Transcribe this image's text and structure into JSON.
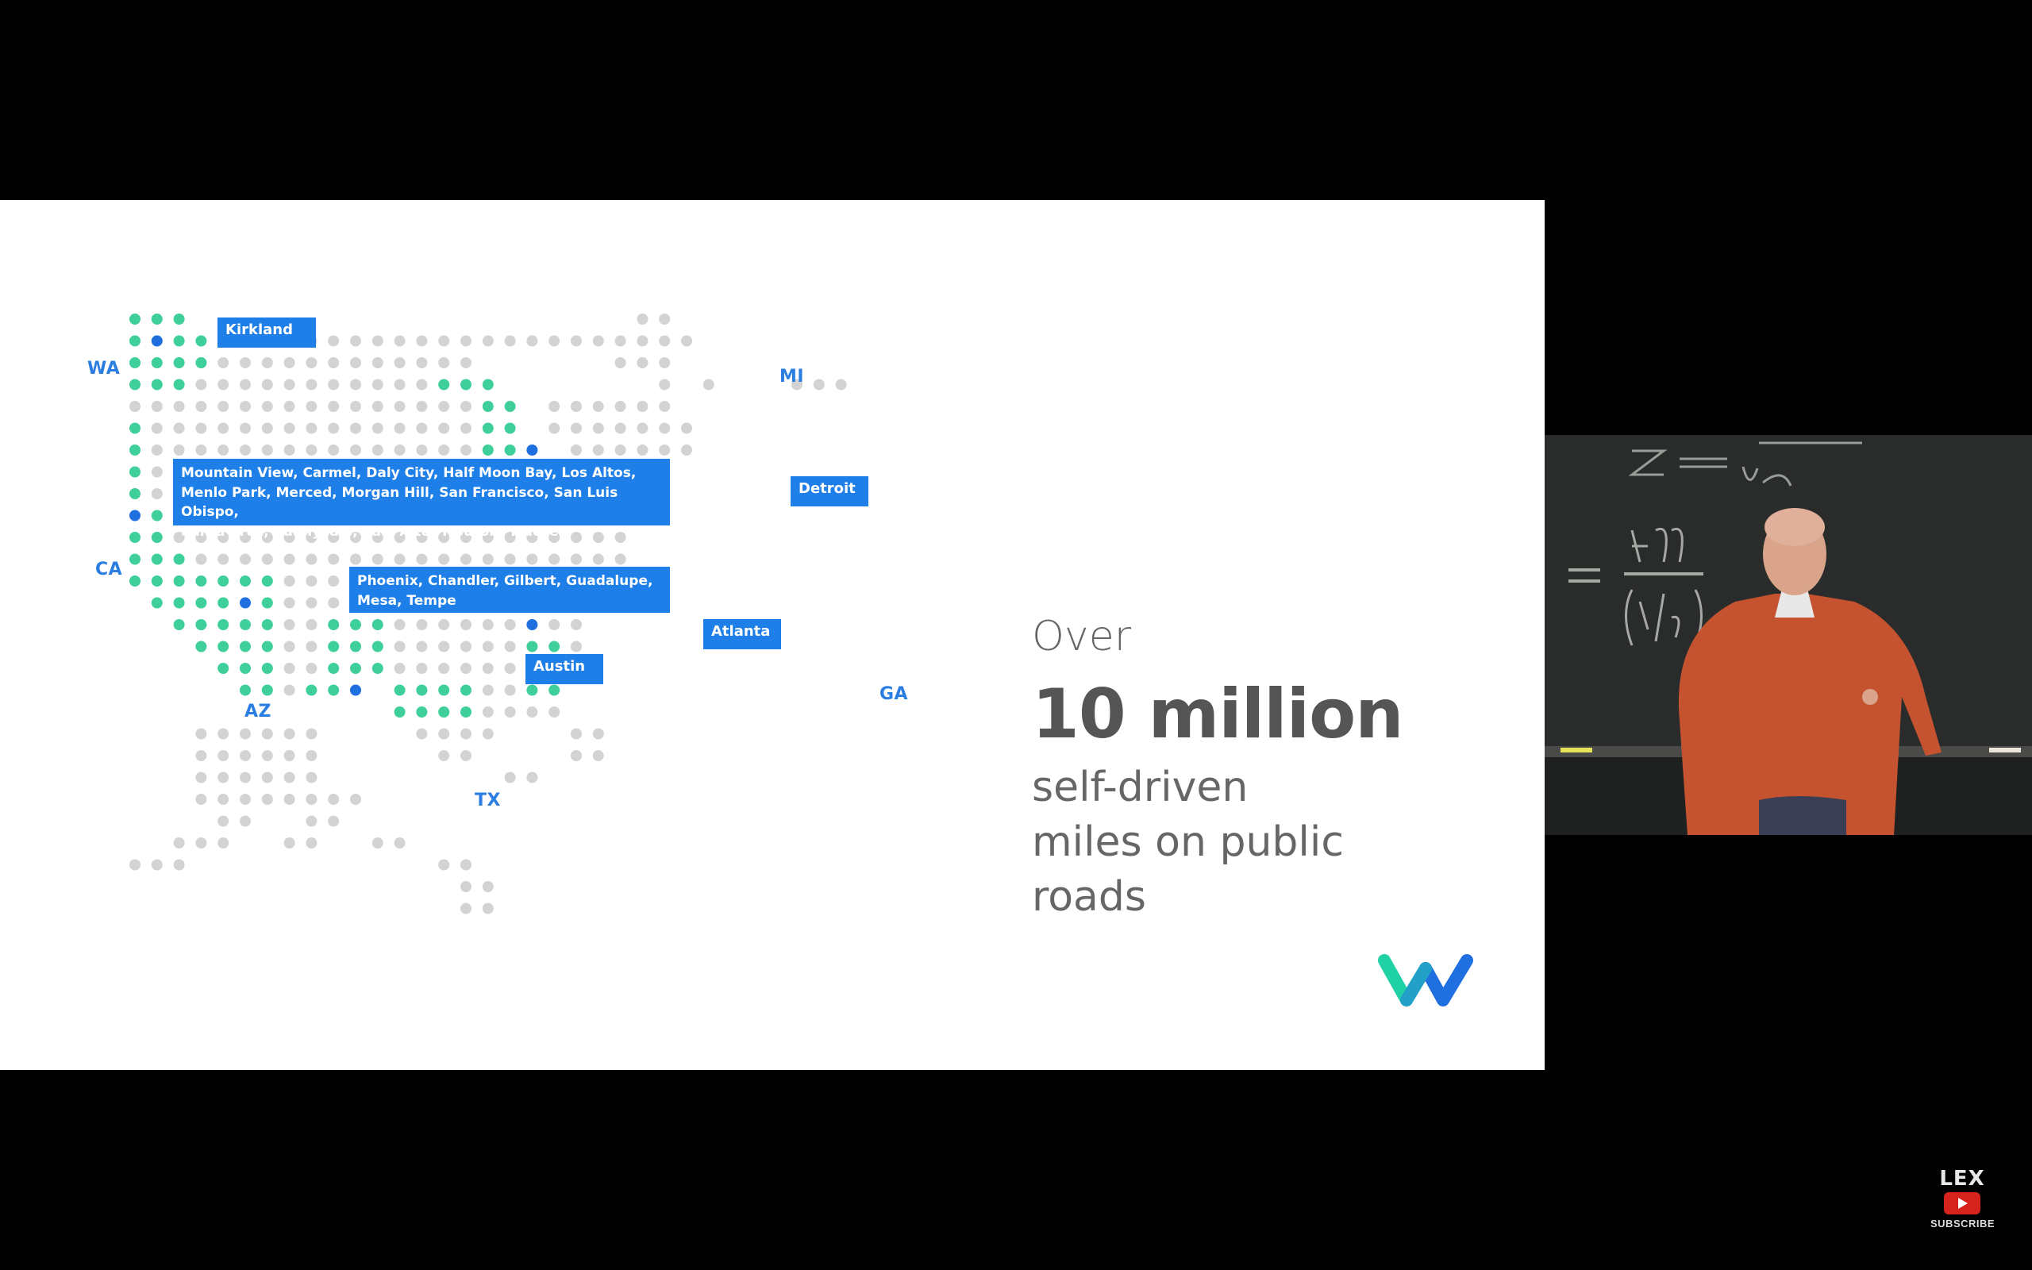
{
  "states": {
    "wa": "WA",
    "ca": "CA",
    "az": "AZ",
    "tx": "TX",
    "mi": "MI",
    "ga": "GA"
  },
  "cities": {
    "kirkland": "Kirkland",
    "california": "Mountain View, Carmel, Daly City, Half Moon Bay, Los Altos,\nMenlo Park, Merced, Morgan Hill, San Francisco, San Luis Obispo,\nSanta Cruz, Sunnyvale, Palo Alto, Tiburon, Truckee",
    "arizona": "Phoenix, Chandler, Gilbert, Guadalupe,\nMesa, Tempe",
    "detroit": "Detroit",
    "atlanta": "Atlanta",
    "austin": "Austin"
  },
  "stat": {
    "over": "Over",
    "big": "10 million",
    "sub": "self-driven\nmiles on public\nroads"
  },
  "colors": {
    "dot_gray": "#d3d3d3",
    "dot_teal": "#3fcf9b",
    "dot_blue": "#1f6fe0",
    "label_blue": "#2a7de1",
    "box_blue": "#1f7fe8",
    "logo_teal": "#1fd1a5",
    "logo_blue": "#1f6fe0"
  },
  "watermark": {
    "name": "LEX",
    "subscribe": "SUBSCRIBE",
    "icon": "youtube-play-icon"
  }
}
